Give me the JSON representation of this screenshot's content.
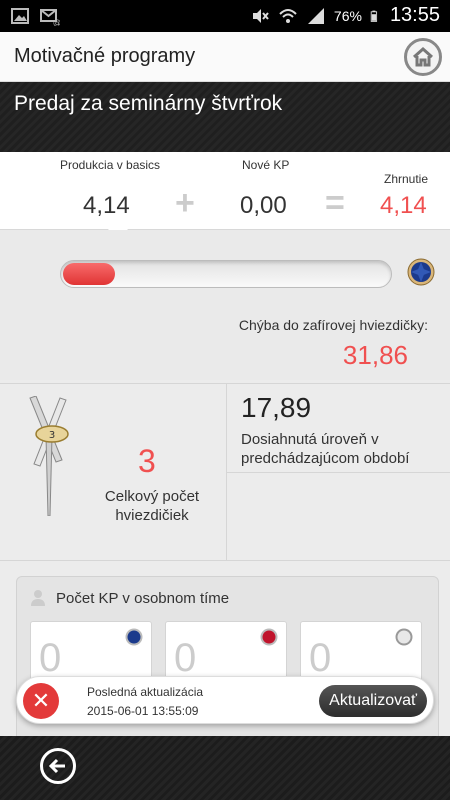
{
  "status_bar": {
    "battery": "76%",
    "time": "13:55",
    "icons": [
      "gallery-icon",
      "email-icon",
      "mute-icon",
      "wifi-icon",
      "signal-icon",
      "battery-icon"
    ]
  },
  "app_bar": {
    "title": "Motivačné programy",
    "home_icon": "home-icon"
  },
  "section": {
    "title": "Predaj za seminárny štvrťrok"
  },
  "summary": {
    "production_label": "Produkcia v basics",
    "production_value": "4,14",
    "plus": "+",
    "new_kp_label": "Nové KP",
    "new_kp_value": "0,00",
    "equals": "=",
    "total_label": "Zhrnutie",
    "total_value": "4,14"
  },
  "progress": {
    "fraction": 0.16,
    "missing_label": "Chýba do zafírovej hviezdičky:",
    "missing_value": "31,86",
    "gem_icon": "sapphire-gem-icon"
  },
  "stars": {
    "badge_number": "3",
    "count": "3",
    "label": "Celkový počet hviezdičiek"
  },
  "level": {
    "value": "17,89",
    "label": "Dosiahnutá úroveň v predchádzajúcom období"
  },
  "team": {
    "title": "Počet KP v osobnom tíme",
    "cards": [
      {
        "value": "0",
        "gem": "sapphire-gem-icon",
        "color": "#1b3a8c"
      },
      {
        "value": "0",
        "gem": "ruby-gem-icon",
        "color": "#c0142c"
      },
      {
        "value": "0",
        "gem": "diamond-gem-icon",
        "color": "#bfbfbf"
      }
    ]
  },
  "toast": {
    "title": "Posledná aktualizácia",
    "timestamp": "2015-06-01 13:55:09",
    "button": "Aktualizovať"
  },
  "colors": {
    "accent_red": "#f05050",
    "dark_header": "#222222"
  }
}
